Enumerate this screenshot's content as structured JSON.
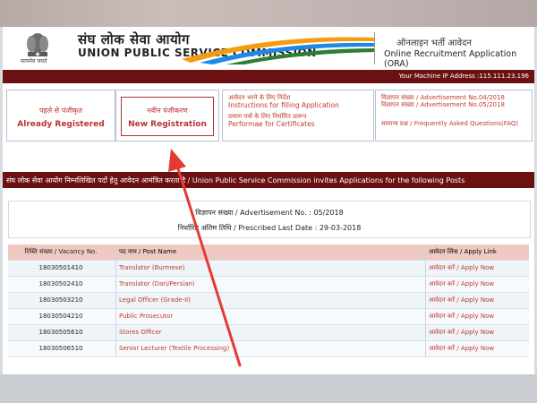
{
  "header": {
    "emblem_text": "सत्यमेव जयते",
    "title_hindi": "संघ लोक सेवा आयोग",
    "title_english": "UNION PUBLIC SERVICE COMMISSION",
    "ora_hindi": "ऑनलाइन भर्ती आवेदन",
    "ora_english": "Online Recruitment Application (ORA)"
  },
  "ip_bar": {
    "text": "Your Machine IP Address :115.111.23.196"
  },
  "registration": {
    "already": {
      "hindi": "पहले से पंजीकृत",
      "english": "Already Registered"
    },
    "new": {
      "hindi": "नवीन पंजीकरण",
      "english": "New Registration"
    }
  },
  "links_left": {
    "instructions_hi": "आवेदन भरने के लिए निर्देश",
    "instructions_en": "Instructions for filling Application",
    "certificates_hi": "प्रमाण पत्रों के लिए निर्धारित प्रारूप",
    "certificates_en": "Performae for Certificates"
  },
  "links_right": {
    "adv1": "विज्ञापन संख्या / Advertisement No.04/2018",
    "adv2": "विज्ञापन संख्या / Advertisement No.05/2018",
    "faq": "सामान्य प्रश्न / Frequently Asked Questions(FAQ)"
  },
  "marquee": {
    "text": "संघ लोक सेवा आयोग निम्नलिखित पदों हेतु आवेदन आमंत्रित करता है / Union Public Service Commission invites Applications for the following Posts"
  },
  "advertisement": {
    "number": "विज्ञापन संख्या / Advertisement No. : 05/2018",
    "last_date": "निर्धारित अंतिम तिथि / Prescribed Last Date : 29-03-2018"
  },
  "table": {
    "headers": {
      "vacancy": "रिक्ति संख्या / Vacancy No.",
      "post": "पद नाम / Post Name",
      "apply": "आवेदन लिंक / Apply Link"
    },
    "rows": [
      {
        "vacancy": "18030501410",
        "post": "Translator (Burmese)",
        "apply": "आवेदन करें / Apply Now"
      },
      {
        "vacancy": "18030502410",
        "post": "Translator (Dari/Persian)",
        "apply": "आवेदन करें / Apply Now"
      },
      {
        "vacancy": "18030503210",
        "post": "Legal Officer (Grade-II)",
        "apply": "आवेदन करें / Apply Now"
      },
      {
        "vacancy": "18030504210",
        "post": "Public Prosecutor",
        "apply": "आवेदन करें / Apply Now"
      },
      {
        "vacancy": "18030505610",
        "post": "Stores Officer",
        "apply": "आवेदन करें / Apply Now"
      },
      {
        "vacancy": "18030506510",
        "post": "Senior Lecturer (Textile Processing)",
        "apply": "आवेदन करें / Apply Now"
      }
    ]
  },
  "colors": {
    "maroon_bar": "#6b1111",
    "link_red": "#c0392b",
    "arrow": "#e53935"
  }
}
